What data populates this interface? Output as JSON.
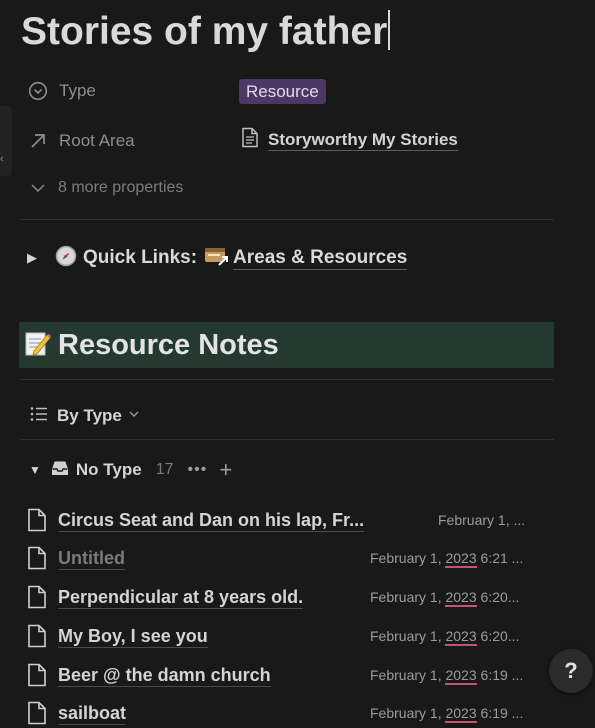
{
  "page": {
    "title": "Stories of my father"
  },
  "properties": {
    "type": {
      "label": "Type",
      "value": "Resource",
      "tag_color": "#4d3766"
    },
    "root_area": {
      "label": "Root Area",
      "value": "Storyworthy My Stories"
    },
    "more": "8 more properties"
  },
  "quick_links": {
    "label": "Quick Links:",
    "link": "Areas & Resources"
  },
  "resource_notes": {
    "heading": "Resource Notes",
    "bg_color": "#243a31"
  },
  "view": {
    "label": "By Type"
  },
  "group": {
    "label": "No Type",
    "count": "17"
  },
  "notes": [
    {
      "title": "Circus Seat and Dan on his lap, Fr...",
      "date": "February 1, ..."
    },
    {
      "title": "Untitled",
      "date_prefix": "February 1, ",
      "year": "2023",
      "date_suffix": " 6:21 ..."
    },
    {
      "title": "Perpendicular at 8 years old.",
      "date_prefix": "February 1, ",
      "year": "2023",
      "date_suffix": " 6:20..."
    },
    {
      "title": "My Boy, I see you",
      "date_prefix": "February 1, ",
      "year": "2023",
      "date_suffix": " 6:20..."
    },
    {
      "title": "Beer @ the damn church",
      "date_prefix": "February 1, ",
      "year": "2023",
      "date_suffix": " 6:19 ..."
    },
    {
      "title": "sailboat",
      "date_prefix": "February 1, ",
      "year": "2023",
      "date_suffix": " 6:19 ..."
    }
  ],
  "help": {
    "label": "?"
  }
}
